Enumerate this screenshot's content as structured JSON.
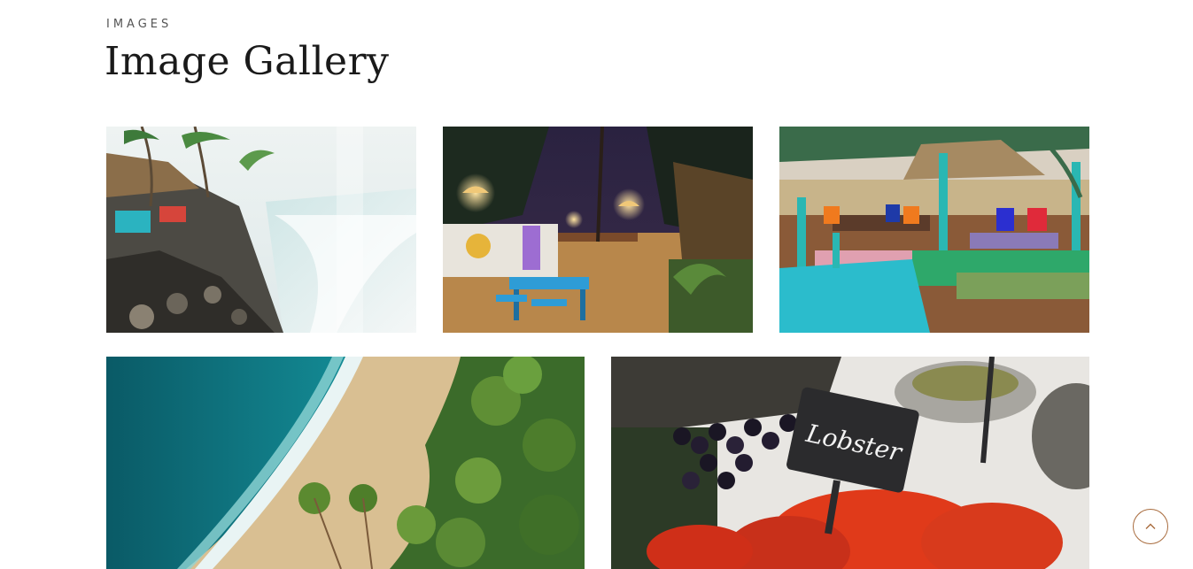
{
  "section": {
    "eyebrow": "IMAGES",
    "title": "Image Gallery"
  },
  "gallery": {
    "images": [
      {
        "subject": "rocky shoreline with beach huts and palms"
      },
      {
        "subject": "night garden restaurant with lanterns and blue tables"
      },
      {
        "subject": "colorful beach shack seating with cushions"
      },
      {
        "subject": "aerial view of turquoise sea, sandy beach and palm trees"
      },
      {
        "subject": "lobsters on ice with chalkboard sign"
      }
    ],
    "lobster_sign": "Lobster"
  },
  "colors": {
    "accent": "#a86b3d",
    "title": "#1a1a1a",
    "eyebrow": "#555555"
  },
  "icons": {
    "scroll_top": "chevron-up-icon"
  }
}
